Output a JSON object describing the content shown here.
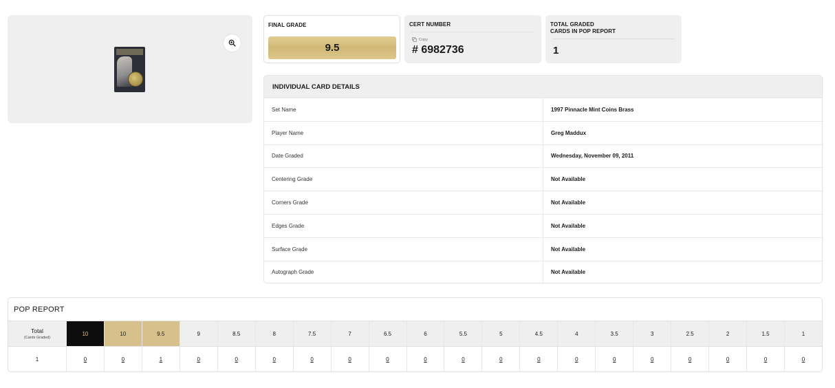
{
  "icons": {
    "zoom": "zoom-in-icon",
    "copy": "copy-icon"
  },
  "colors": {
    "gold": "#d6c08b",
    "black_grade": "#0d0d0d",
    "panel_bg": "#efefef"
  },
  "summary": {
    "final_grade_label": "FINAL GRADE",
    "final_grade_value": "9.5",
    "cert_label": "CERT NUMBER",
    "copy_label": "Copy",
    "cert_value": "# 6982736",
    "pop_label_line1": "TOTAL GRADED",
    "pop_label_line2": "CARDS IN POP REPORT",
    "pop_value": "1"
  },
  "details": {
    "header": "INDIVIDUAL CARD DETAILS",
    "rows": [
      {
        "label": "Set Name",
        "value": "1997 Pinnacle Mint Coins Brass"
      },
      {
        "label": "Player Name",
        "value": "Greg Maddux"
      },
      {
        "label": "Date Graded",
        "value": "Wednesday, November 09, 2011"
      },
      {
        "label": "Centering Grade",
        "value": "Not Available"
      },
      {
        "label": "Corners Grade",
        "value": "Not Available"
      },
      {
        "label": "Edges Grade",
        "value": "Not Available"
      },
      {
        "label": "Surface Grade",
        "value": "Not Available"
      },
      {
        "label": "Autograph Grade",
        "value": "Not Available"
      }
    ]
  },
  "pop_report": {
    "title": "POP REPORT",
    "total_label": "Total",
    "total_sublabel": "(Cards Graded)",
    "total_value": "1",
    "grades": [
      "10",
      "10",
      "9.5",
      "9",
      "8.5",
      "8",
      "7.5",
      "7",
      "6.5",
      "6",
      "5.5",
      "5",
      "4.5",
      "4",
      "3.5",
      "3",
      "2.5",
      "2",
      "1.5",
      "1"
    ],
    "counts": [
      "0",
      "0",
      "1",
      "0",
      "0",
      "0",
      "0",
      "0",
      "0",
      "0",
      "0",
      "0",
      "0",
      "0",
      "0",
      "0",
      "0",
      "0",
      "0",
      "0"
    ]
  }
}
